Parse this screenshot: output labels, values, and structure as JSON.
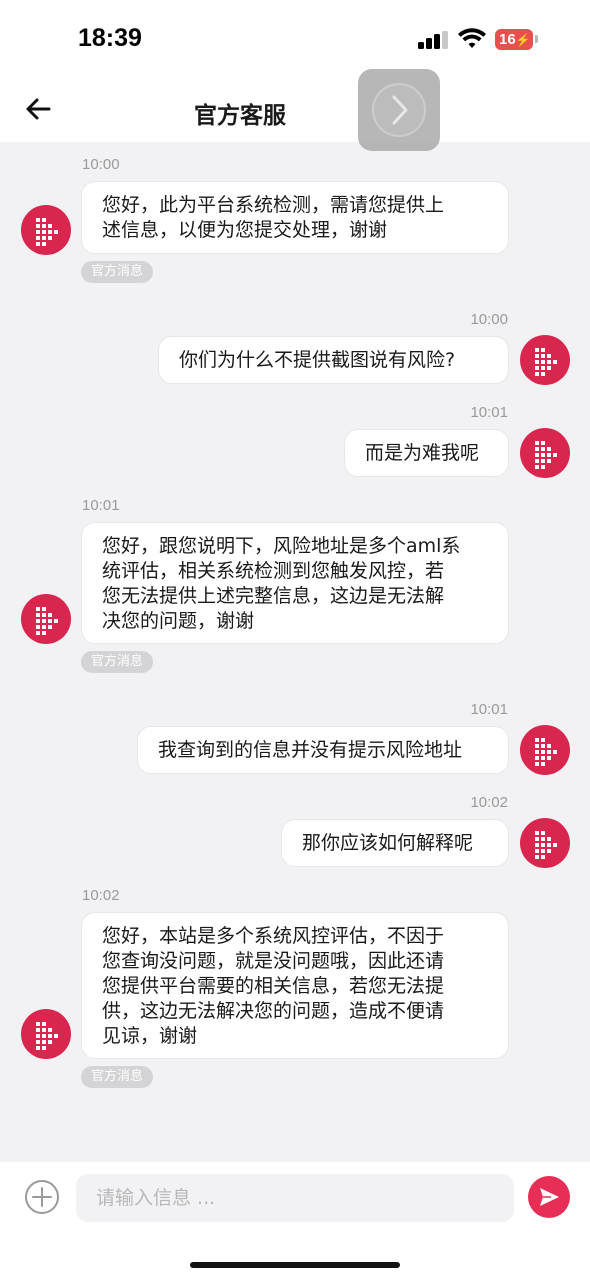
{
  "status_bar": {
    "time": "18:39",
    "battery": "16"
  },
  "nav": {
    "title": "官方客服"
  },
  "messages": [
    {
      "side": "left",
      "time": "10:00",
      "text": "您好，此为平台系统检测，需请您提供上\n述信息，以便为您提交处理，谢谢",
      "tag": "官方消息"
    },
    {
      "side": "right",
      "time": "10:00",
      "text": "你们为什么不提供截图说有风险?"
    },
    {
      "side": "right",
      "time": "10:01",
      "text": "而是为难我呢"
    },
    {
      "side": "left",
      "time": "10:01",
      "text": "您好，跟您说明下，风险地址是多个aml系\n统评估，相关系统检测到您触发风控，若\n您无法提供上述完整信息，这边是无法解\n决您的问题，谢谢",
      "tag": "官方消息"
    },
    {
      "side": "right",
      "time": "10:01",
      "text": "我查询到的信息并没有提示风险地址"
    },
    {
      "side": "right",
      "time": "10:02",
      "text": "那你应该如何解释呢"
    },
    {
      "side": "left",
      "time": "10:02",
      "text": "您好，本站是多个系统风控评估，不因于\n您查询没问题，就是没问题哦，因此还请\n您提供平台需要的相关信息，若您无法提\n供，这边无法解决您的问题，造成不便请\n见谅，谢谢",
      "tag": "官方消息"
    }
  ],
  "input": {
    "placeholder": "请输入信息 ..."
  },
  "colors": {
    "accent": "#e62e57",
    "avatar": "#d8264f",
    "background": "#f2f2f4"
  },
  "icons": [
    "back-arrow-icon",
    "chevron-right-icon",
    "plus-circle-icon",
    "send-icon",
    "brand-logo-icon"
  ]
}
